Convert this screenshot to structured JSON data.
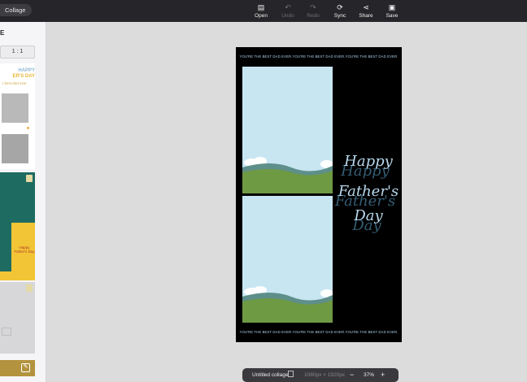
{
  "toolbar": {
    "collage_pill": "Collage",
    "tools": [
      {
        "icon": "open-icon",
        "glyph": "▤",
        "label": "Open",
        "enabled": true
      },
      {
        "icon": "undo-icon",
        "glyph": "↶",
        "label": "Undo",
        "enabled": false
      },
      {
        "icon": "redo-icon",
        "glyph": "↷",
        "label": "Redo",
        "enabled": false
      },
      {
        "icon": "sync-icon",
        "glyph": "⟳",
        "label": "Sync",
        "enabled": true
      },
      {
        "icon": "share-icon",
        "glyph": "⋖",
        "label": "Share",
        "enabled": true
      },
      {
        "icon": "save-icon",
        "glyph": "▣",
        "label": "Save",
        "enabled": true
      }
    ]
  },
  "left_panel": {
    "heading": "E",
    "ratio_label": "1 : 1",
    "template1": {
      "title_line1": "HAPPY",
      "title_line2": "ER'S DAY",
      "subtitle": "t best dad ever."
    },
    "template2": {
      "caption": "Happy Father's Day"
    }
  },
  "poster": {
    "banner_text": "YOU'RE THE BEST DAD EVER.YOU'RE THE BEST DAD EVER.YOU'RE THE BEST DAD EVER.",
    "script_line1": "Happy",
    "script_line2": "Father's",
    "script_line3": "Day",
    "colors": {
      "background": "#000000",
      "sky": "#c8e6f2",
      "grass": "#6f9a44",
      "text": "#b7d8ec"
    }
  },
  "status_bar": {
    "doc_title": "Untitled collage",
    "dimensions": "1080px × 1920px",
    "zoom": "37%",
    "minus": "−",
    "plus": "+"
  }
}
